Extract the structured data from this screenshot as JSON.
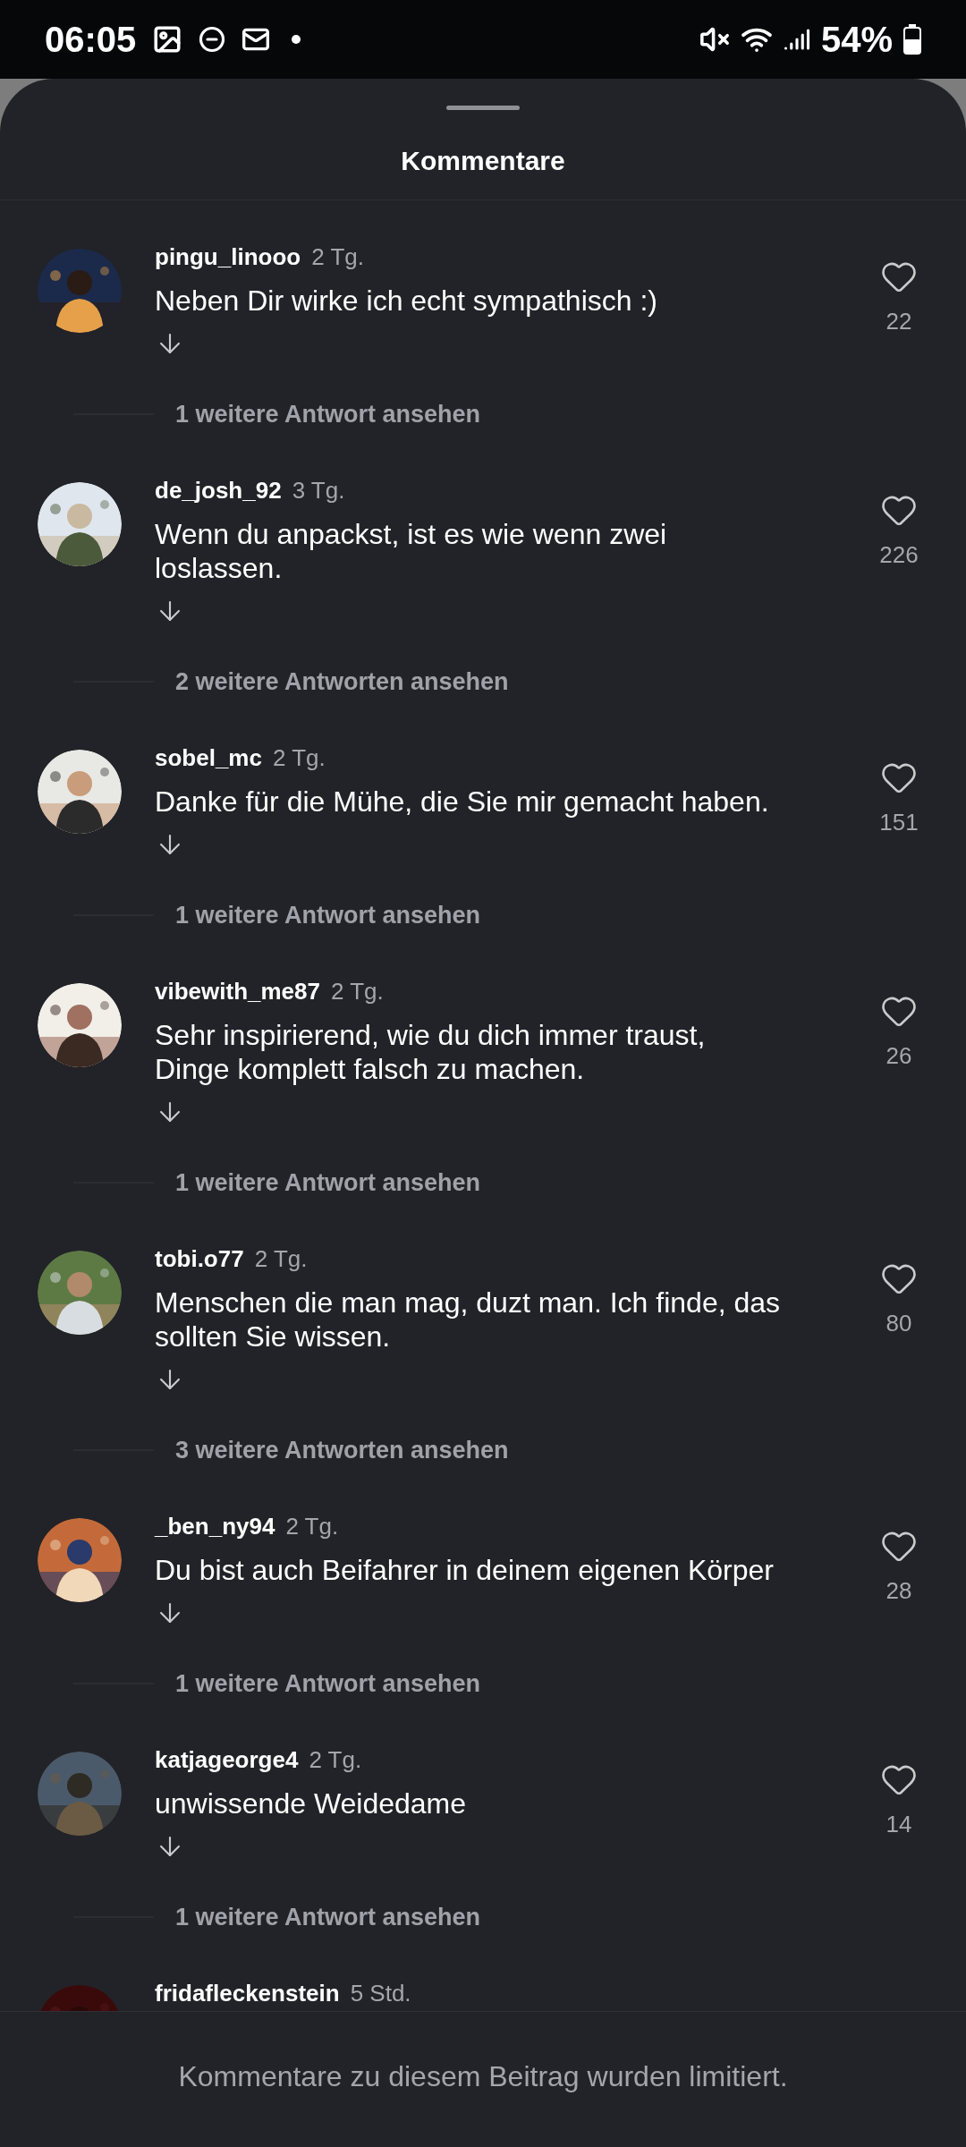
{
  "status_bar": {
    "time": "06:05",
    "battery": "54%"
  },
  "sheet": {
    "title": "Kommentare"
  },
  "comments": [
    {
      "username": "pingu_linooo",
      "time": "2 Tg.",
      "text": "Neben Dir wirke ich echt sympathisch :)",
      "likes": "22",
      "replies": "1 weitere Antwort ansehen"
    },
    {
      "username": "de_josh_92",
      "time": "3 Tg.",
      "text": "Wenn du anpackst, ist es wie wenn zwei\nloslassen.",
      "likes": "226",
      "replies": "2 weitere Antworten ansehen"
    },
    {
      "username": "sobel_mc",
      "time": "2 Tg.",
      "text": "Danke für die Mühe, die Sie mir gemacht haben.",
      "likes": "151",
      "replies": "1 weitere Antwort ansehen"
    },
    {
      "username": "vibewith_me87",
      "time": "2 Tg.",
      "text": "Sehr inspirierend, wie du dich immer traust,\nDinge komplett falsch zu machen.",
      "likes": "26",
      "replies": "1 weitere Antwort ansehen"
    },
    {
      "username": "tobi.o77",
      "time": "2 Tg.",
      "text": "Menschen die man mag, duzt man. Ich finde, das\nsollten Sie wissen.",
      "likes": "80",
      "replies": "3 weitere Antworten ansehen"
    },
    {
      "username": "_ben_ny94",
      "time": "2 Tg.",
      "text": "Du bist auch Beifahrer in deinem eigenen Körper",
      "likes": "28",
      "replies": "1 weitere Antwort ansehen"
    },
    {
      "username": "katjageorge4",
      "time": "2 Tg.",
      "text": "unwissende Weidedame",
      "likes": "14",
      "replies": "1 weitere Antwort ansehen"
    },
    {
      "username": "fridafleckenstein",
      "time": "5 Std."
    }
  ],
  "footer": "Kommentare zu diesem Beitrag wurden limitiert."
}
